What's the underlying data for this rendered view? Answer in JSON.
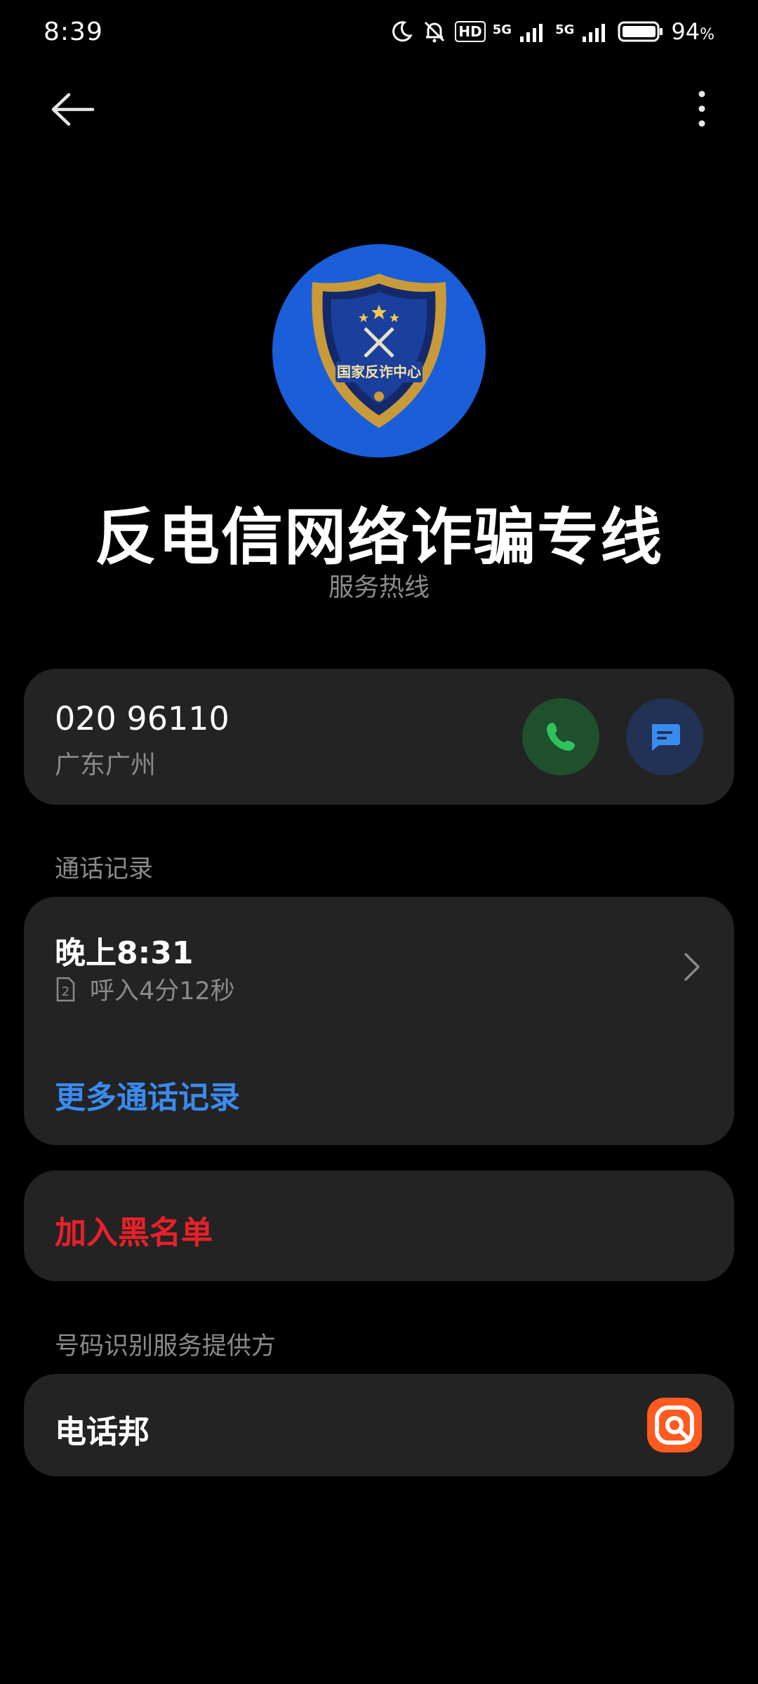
{
  "status_bar": {
    "time": "8:39",
    "battery_percent": "94",
    "battery_unit": "%",
    "network_1": "5G",
    "network_2": "5G",
    "hd_badge": "HD"
  },
  "top_bar": {
    "back_icon": "back-arrow-icon",
    "more_icon": "more-vertical-icon"
  },
  "contact": {
    "avatar_text": "国家反诈中心",
    "name": "反电信网络诈骗专线",
    "subtitle": "服务热线"
  },
  "number_card": {
    "number": "020 96110",
    "location": "广东广州",
    "call_icon": "phone-icon",
    "message_icon": "message-icon"
  },
  "call_log": {
    "section_label": "通话记录",
    "time": "晚上8:31",
    "sim": "2",
    "detail": "呼入4分12秒",
    "more_label": "更多通话记录"
  },
  "block": {
    "label": "加入黑名单"
  },
  "provider": {
    "section_label": "号码识别服务提供方",
    "name": "电话邦"
  },
  "colors": {
    "background": "#000000",
    "card": "#232323",
    "accent_blue": "#3a8bf0",
    "danger_red": "#e8202a",
    "call_green": "#2fc25b",
    "provider_orange": "#ff5a1f"
  }
}
